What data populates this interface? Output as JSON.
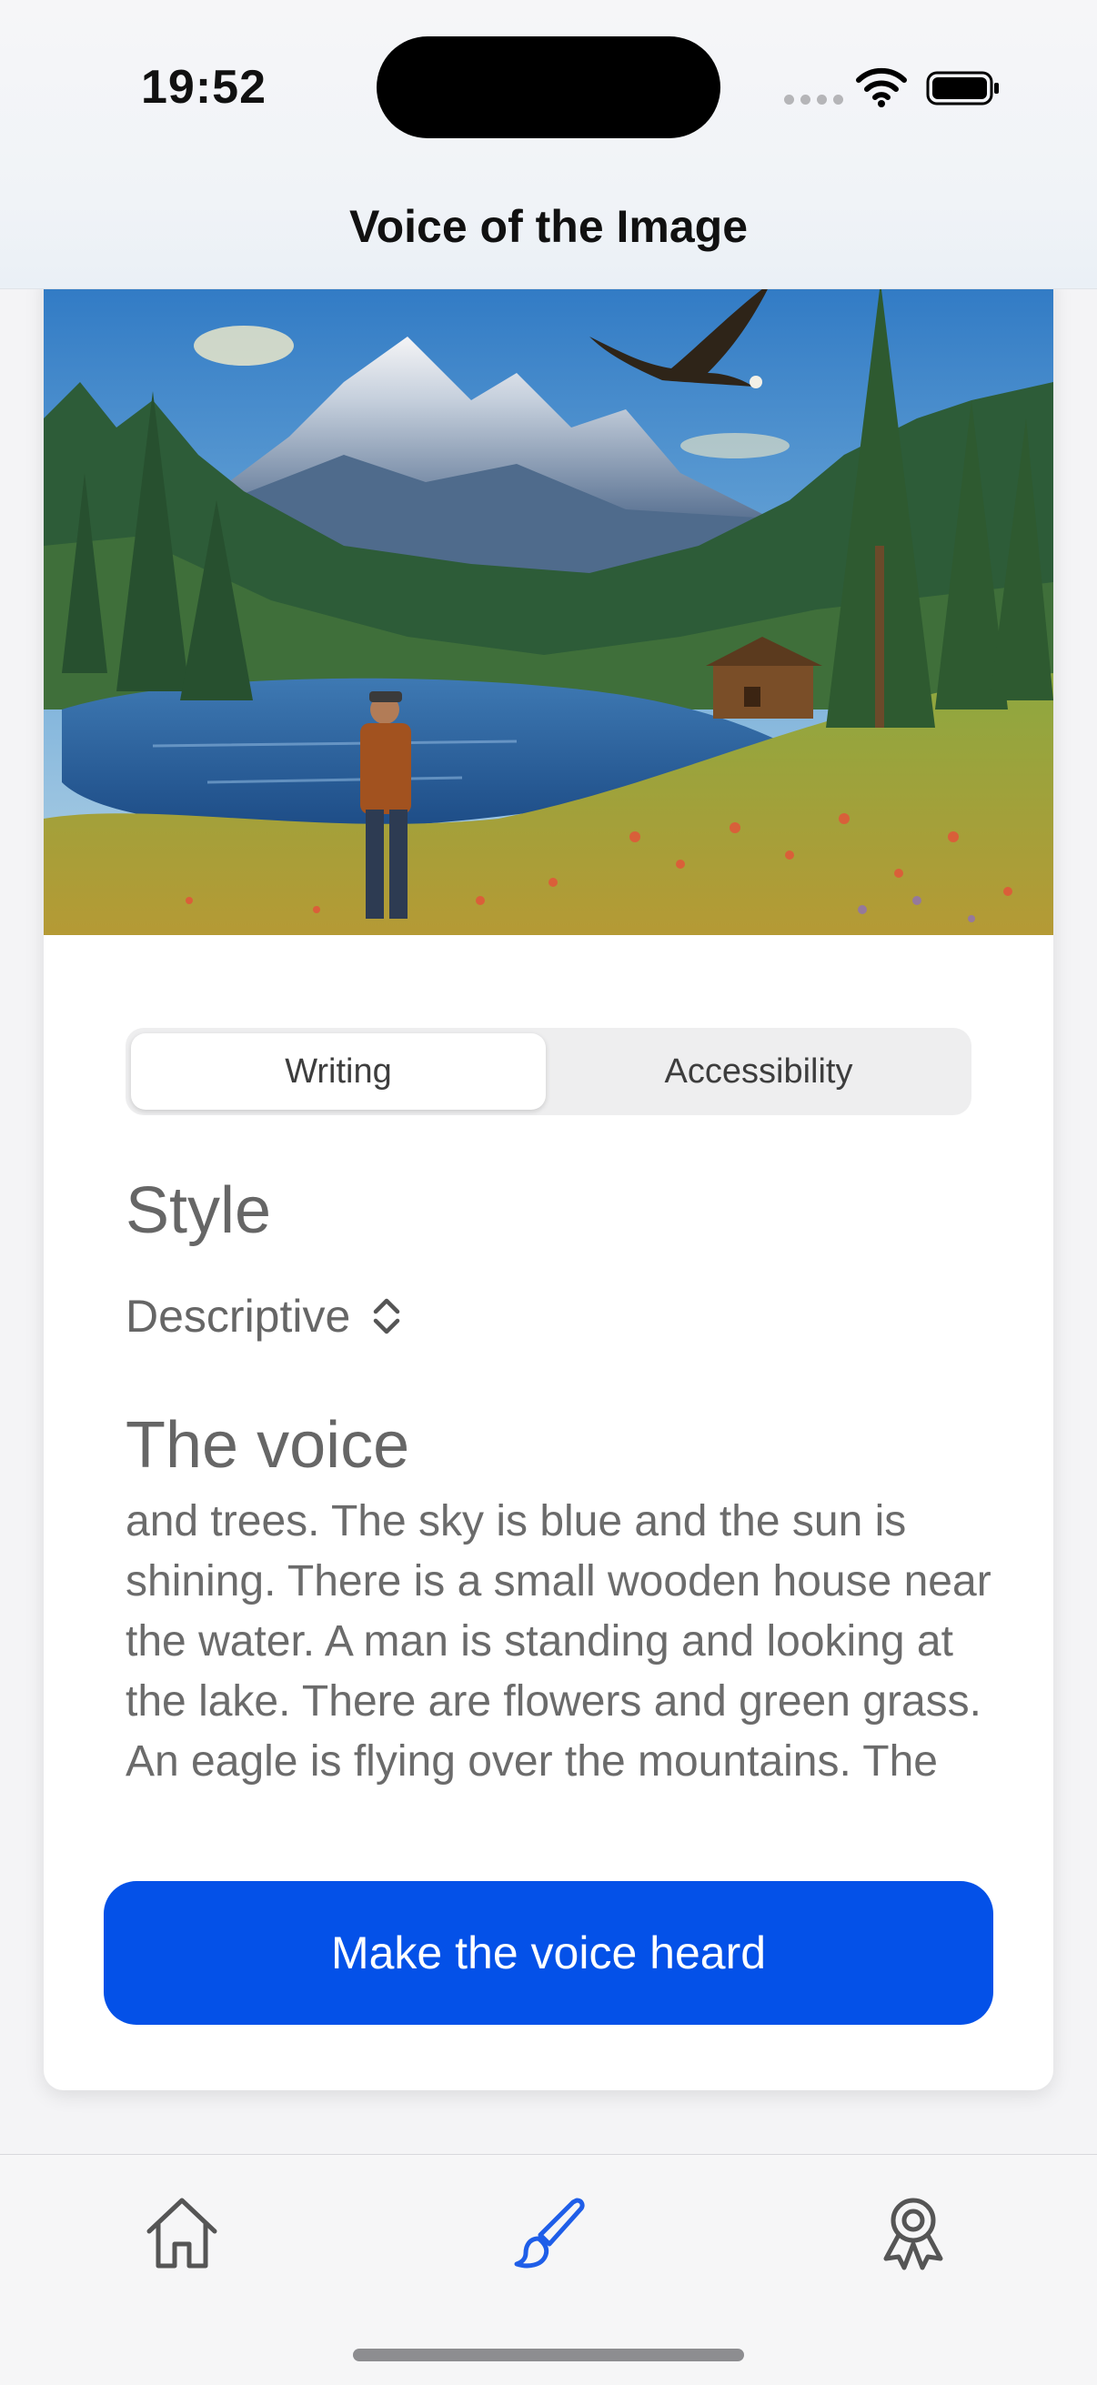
{
  "status_bar": {
    "time": "19:52"
  },
  "nav": {
    "title": "Voice of the Image"
  },
  "hero": {
    "alt": "Painting of a mountain lake with a man, cabin, pine trees and an eagle"
  },
  "segmented": {
    "selected": "Writing",
    "options": [
      "Writing",
      "Accessibility"
    ]
  },
  "style": {
    "heading": "Style",
    "selected_value": "Descriptive"
  },
  "voice": {
    "heading": "The voice",
    "text": "and trees. The sky is blue and the sun is shining. There is a small wooden house near the water. A man is standing and looking at the lake. There are flowers and green grass. An eagle is flying over the mountains. The place looks calm and"
  },
  "cta": {
    "label": "Make the voice heard"
  },
  "tab_bar": {
    "items": [
      {
        "icon": "home-icon",
        "active": false
      },
      {
        "icon": "paintbrush-icon",
        "active": true
      },
      {
        "icon": "award-icon",
        "active": false
      }
    ],
    "active_color": "#1f5ee8",
    "inactive_color": "#555555"
  },
  "colors": {
    "accent": "#0451e8"
  }
}
